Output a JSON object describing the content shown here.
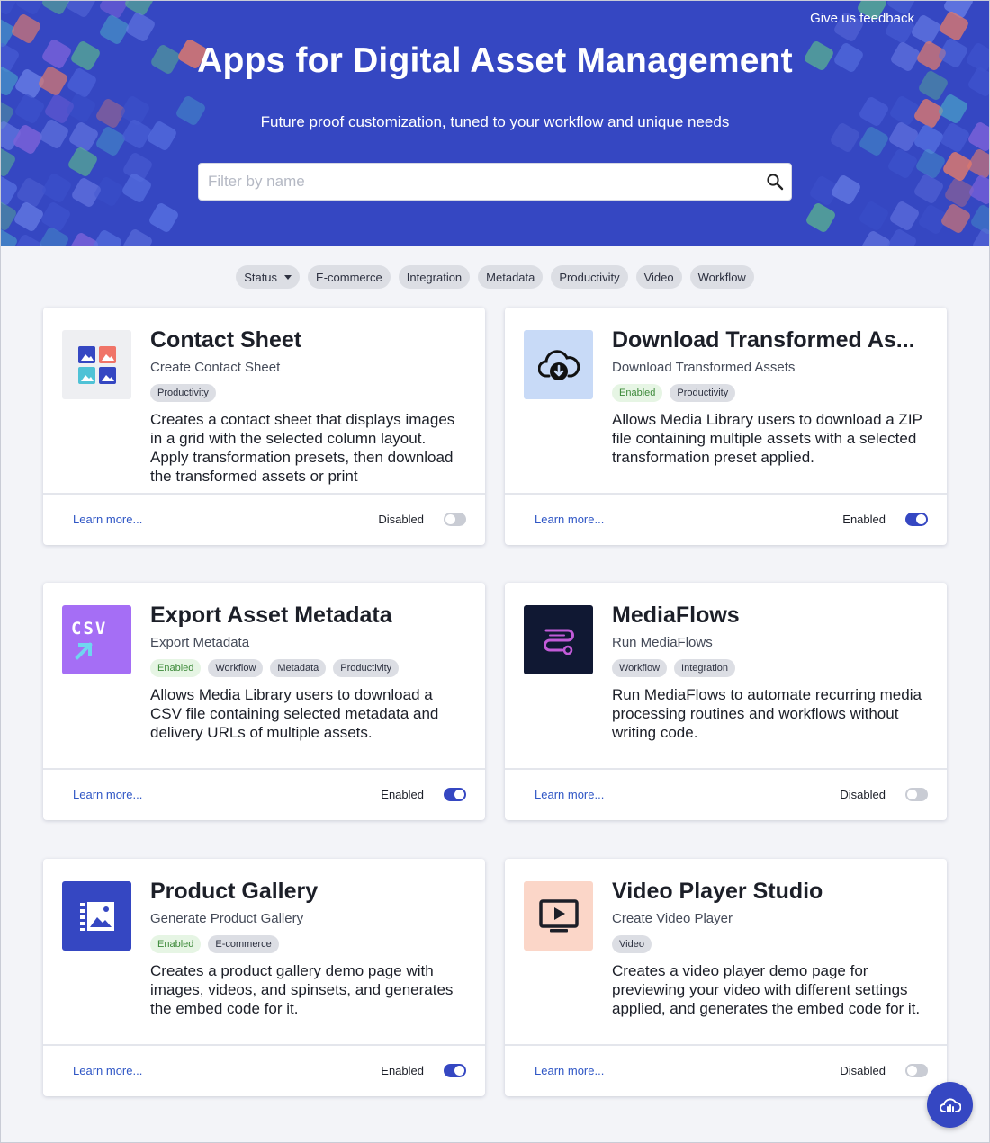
{
  "header": {
    "feedback_link": "Give us feedback",
    "title": "Apps for Digital Asset Management",
    "subtitle": "Future proof customization, tuned to your workflow and unique needs",
    "search_placeholder": "Filter by name",
    "search_value": ""
  },
  "filters": [
    {
      "label": "Status",
      "has_dropdown": true
    },
    {
      "label": "E-commerce"
    },
    {
      "label": "Integration"
    },
    {
      "label": "Metadata"
    },
    {
      "label": "Productivity"
    },
    {
      "label": "Video"
    },
    {
      "label": "Workflow"
    }
  ],
  "learn_more_label": "Learn more...",
  "colors": {
    "brand": "#3547c2",
    "link": "#2f56c5",
    "enabled_tag_bg": "#e6f5e4",
    "enabled_tag_text": "#3d8a3a",
    "chip_bg": "#dcdee4"
  },
  "cards": [
    {
      "title": "Contact Sheet",
      "subtitle": "Create Contact Sheet",
      "tags": [
        "Productivity"
      ],
      "description": "Creates a contact sheet that displays images in a grid with the selected column layout. Apply transformation presets, then download the transformed assets or print",
      "status": "Disabled",
      "enabled": false,
      "icon": "image-grid-icon",
      "icon_bg": "#eeeff2"
    },
    {
      "title": "Download Transformed As...",
      "subtitle": "Download Transformed Assets",
      "tags": [
        "Enabled",
        "Productivity"
      ],
      "description": "Allows Media Library users to download a ZIP file containing multiple assets with a selected transformation preset applied.",
      "status": "Enabled",
      "enabled": true,
      "icon": "cloud-download-icon",
      "icon_bg": "#c8daf7"
    },
    {
      "title": "Export Asset Metadata",
      "subtitle": "Export Metadata",
      "tags": [
        "Enabled",
        "Workflow",
        "Metadata",
        "Productivity"
      ],
      "description": "Allows Media Library users to download a CSV file containing selected metadata and delivery URLs of multiple assets.",
      "status": "Enabled",
      "enabled": true,
      "icon": "csv-export-icon",
      "icon_bg": "#a56ef5",
      "icon_text": "CSV"
    },
    {
      "title": "MediaFlows",
      "subtitle": "Run MediaFlows",
      "tags": [
        "Workflow",
        "Integration"
      ],
      "description": "Run MediaFlows to automate recurring media processing routines and workflows without writing code.",
      "status": "Disabled",
      "enabled": false,
      "icon": "mediaflows-icon",
      "icon_bg": "#101833"
    },
    {
      "title": "Product Gallery",
      "subtitle": "Generate Product Gallery",
      "tags": [
        "Enabled",
        "E-commerce"
      ],
      "description": "Creates a product gallery demo page with images, videos, and spinsets, and generates the embed code for it.",
      "status": "Enabled",
      "enabled": true,
      "icon": "gallery-image-icon",
      "icon_bg": "#3547c2"
    },
    {
      "title": "Video Player Studio",
      "subtitle": "Create Video Player",
      "tags": [
        "Video"
      ],
      "description": "Creates a video player demo page for previewing your video with different settings applied, and generates the embed code for it.",
      "status": "Disabled",
      "enabled": false,
      "icon": "video-player-icon",
      "icon_bg": "#fbd6c8"
    }
  ],
  "fab": {
    "icon": "cloud-chat-icon"
  }
}
